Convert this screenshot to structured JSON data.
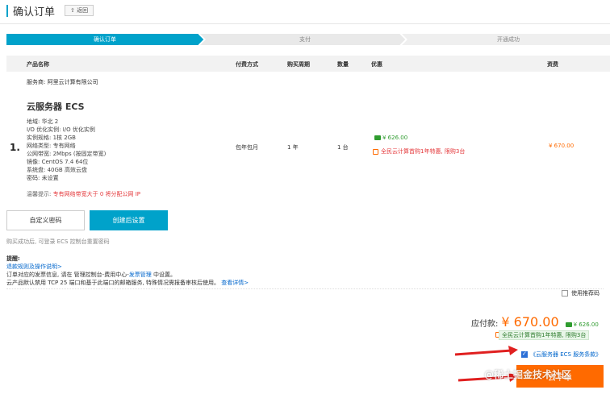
{
  "header": {
    "title": "确认订单",
    "back_label": "⇧ 返回"
  },
  "steps": [
    {
      "label": "确认订单",
      "active": true
    },
    {
      "label": "支付",
      "active": false
    },
    {
      "label": "开通成功",
      "active": false
    }
  ],
  "table": {
    "headers": [
      "产品名称",
      "付费方式",
      "购买周期",
      "数量",
      "优惠",
      "资费"
    ]
  },
  "product": {
    "provider": "服务商: 阿里云计算有限公司",
    "name": "云服务器 ECS",
    "index": "1.",
    "specs": [
      "地域:    华北 2",
      "I/O 优化实例:    I/O 优化实例",
      "实例规格:    1核 2GB",
      "网络类型:    专有网络",
      "公网带宽:    2Mbps (按固定带宽)",
      "镜像:    CentOS 7.4 64位",
      "系统盘:    40GB 高效云盘",
      "密码:    未设置"
    ],
    "warm_tip_label": "温馨提示:",
    "warm_tip_text": "专有网络带宽大于 0 将分配公网 IP",
    "billing": "包年包月",
    "period": "1 年",
    "quantity": "1 台",
    "discount_amount": "¥ 626.00",
    "discount_promo": "全民云计算首购1年特惠, 限购3台",
    "price": "¥ 670.00"
  },
  "actions": {
    "custom_password": "自定义密码",
    "set_after_create": "创建后设置",
    "note": "购买成功后, 可登录 ECS 控制台重置密码"
  },
  "reminder": {
    "title": "提醒:",
    "rules_link": "退款规则及操作说明>",
    "line1_pre": "订单对应的发票信息, 请在 管理控制台-费用中心-",
    "line1_link": "发票管理",
    "line1_post": " 中设置。",
    "line2": "云产品默认禁用 TCP 25 端口和基于此端口的邮箱服务, 特殊情况需报备审核后使用。",
    "line2_link": "查看详情>"
  },
  "recommend_label": "使用推荐码",
  "summary": {
    "due_label": "应付款:",
    "due_amount": "¥ 670.00",
    "discount": "¥ 626.00",
    "promo": "全民云计算首购1年特惠, 限购3台",
    "agreement": "《云服务器 ECS 服务条款》",
    "submit_label": "去下单"
  },
  "watermark": "@稀土掘金技术社区",
  "colors": {
    "accent": "#00a2ca",
    "price": "#ff6a00",
    "promo_red": "#e4393c",
    "discount_green": "#2f9c2f",
    "arrow_red": "#e02020"
  }
}
